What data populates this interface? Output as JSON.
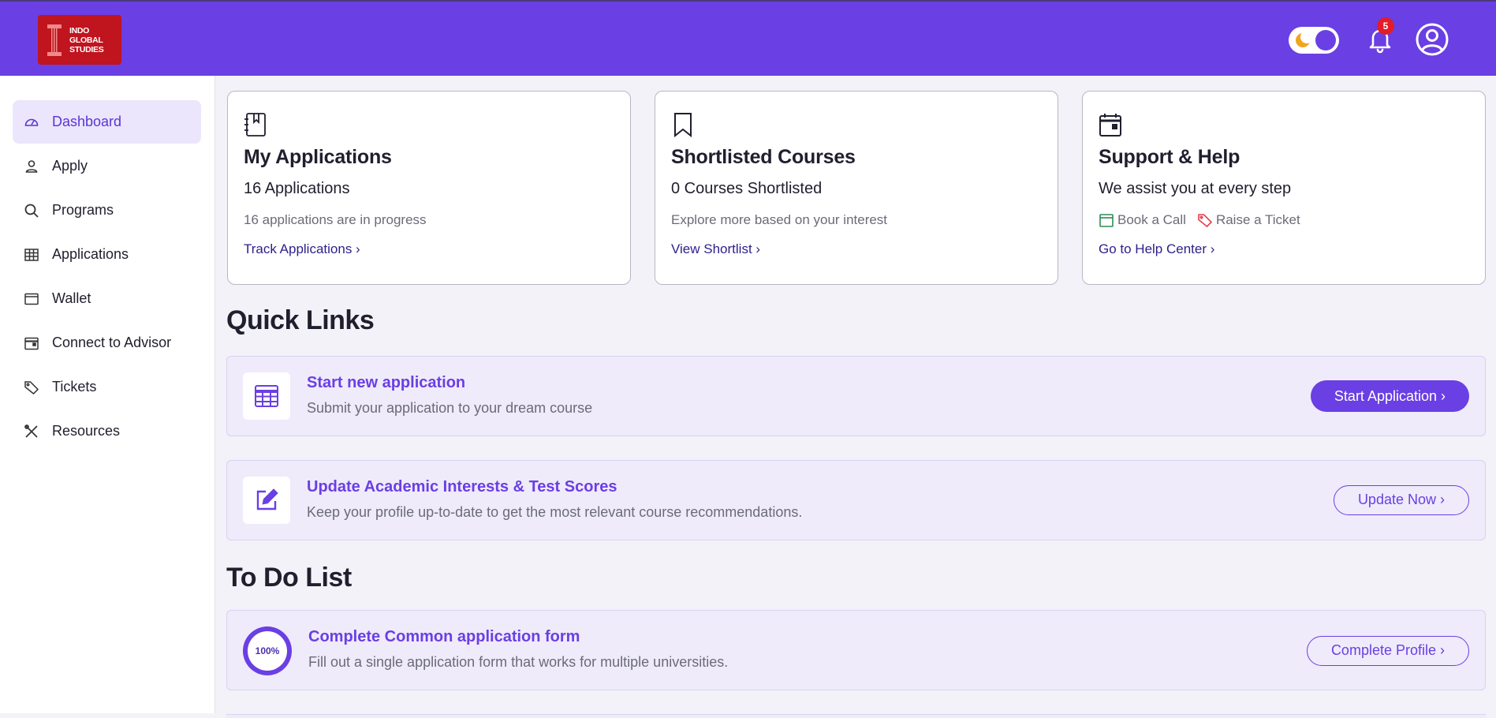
{
  "brand": {
    "logo_text_1": "INDO",
    "logo_text_2": "GLOBAL",
    "logo_text_3": "STUDIES",
    "accent": "#6a3fe3"
  },
  "header": {
    "notifications_count": "5"
  },
  "sidebar": {
    "items": [
      {
        "label": "Dashboard",
        "icon": "gauge-icon"
      },
      {
        "label": "Apply",
        "icon": "person-icon"
      },
      {
        "label": "Programs",
        "icon": "search-icon"
      },
      {
        "label": "Applications",
        "icon": "table-icon"
      },
      {
        "label": "Wallet",
        "icon": "wallet-icon"
      },
      {
        "label": "Connect to Advisor",
        "icon": "calendar-icon"
      },
      {
        "label": "Tickets",
        "icon": "tag-icon"
      },
      {
        "label": "Resources",
        "icon": "tools-icon"
      }
    ]
  },
  "cards": [
    {
      "title": "My Applications",
      "value": "16 Applications",
      "sub": "16 applications are in progress",
      "link": "Track Applications ›",
      "icon": "notebook-icon"
    },
    {
      "title": "Shortlisted Courses",
      "value": "0 Courses Shortlisted",
      "sub": "Explore more based on your interest",
      "link": "View Shortlist ›",
      "icon": "bookmark-icon"
    },
    {
      "title": "Support & Help",
      "value": "We assist you at every step",
      "book_call": "Book a Call",
      "raise_ticket": "Raise a Ticket",
      "link": "Go to Help Center ›",
      "icon": "calendar-icon"
    }
  ],
  "quick_links": {
    "heading": "Quick Links",
    "items": [
      {
        "title": "Start new application",
        "desc": "Submit your application to your dream course",
        "button": "Start Application ›"
      },
      {
        "title": "Update Academic Interests & Test Scores",
        "desc": "Keep your profile up-to-date to get the most relevant course recommendations.",
        "button": "Update Now ›"
      }
    ]
  },
  "todo": {
    "heading": "To Do List",
    "items": [
      {
        "title": "Complete Common application form",
        "desc": "Fill out a single application form that works for multiple universities.",
        "progress_label": "100%",
        "progress": 100,
        "button": "Complete Profile ›"
      }
    ]
  }
}
